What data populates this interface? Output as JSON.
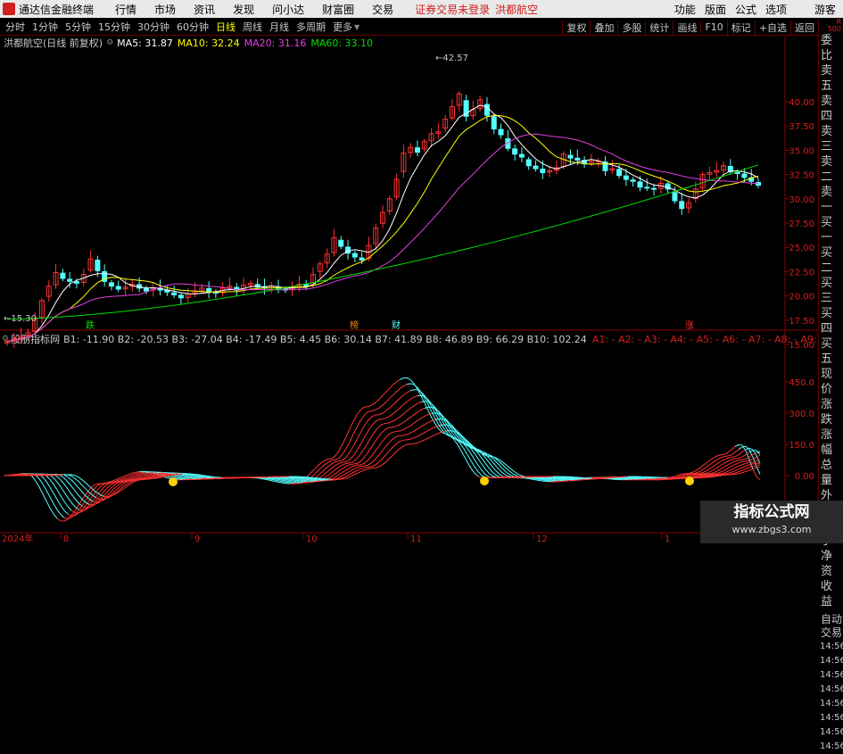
{
  "titlebar": {
    "app": "通达信金融终端",
    "menus": [
      "行情",
      "市场",
      "资讯",
      "发现",
      "问小达",
      "财富圈",
      "交易"
    ],
    "warning": "证券交易未登录",
    "stock": "洪都航空",
    "right": [
      "功能",
      "版面",
      "公式",
      "选项"
    ],
    "guest": "游客"
  },
  "toolbar": {
    "periods": [
      "分时",
      "1分钟",
      "5分钟",
      "15分钟",
      "30分钟",
      "60分钟",
      "日线",
      "周线",
      "月线",
      "多周期",
      "更多"
    ],
    "active": "日线",
    "right": [
      "复权",
      "叠加",
      "多股",
      "统计",
      "画线",
      "F10",
      "标记",
      "+自选",
      "返回"
    ]
  },
  "main_header": {
    "title": "洪都航空(日线 前复权)",
    "ma5": "MA5: 31.87",
    "ma10": "MA10: 32.24",
    "ma20": "MA20: 31.16",
    "ma60": "MA60: 33.10"
  },
  "indicator_header": {
    "title": "股朋指标网",
    "b_values": "B1: -11.90  B2: -20.53  B3: -27.04  B4: -17.49  B5: 4.45  B6: 30.14  B7: 41.89  B8: 46.89  B9: 66.29  B10: 102.24",
    "a_values": "A1: -  A2: -  A3: -  A4: -  A5: -  A6: -  A7: -  A8: -  A9: -  A10: -"
  },
  "sidebar": {
    "top": "R",
    "top2": "500",
    "items": [
      "委比",
      "卖五",
      "卖四",
      "卖三",
      "卖二",
      "卖一",
      "买一",
      "买二",
      "买三",
      "买四",
      "买五",
      "现价",
      "涨跌",
      "涨幅",
      "总量",
      "外盘",
      "换手",
      "净资",
      "收益"
    ],
    "bottom": [
      "自动",
      "交易"
    ],
    "times": [
      "14:56",
      "14:56",
      "14:56",
      "14:56",
      "14:56",
      "14:56",
      "14:56",
      "14:56"
    ]
  },
  "price_axis": [
    "40.00",
    "37.50",
    "35.00",
    "32.50",
    "30.00",
    "27.50",
    "25.00",
    "22.50",
    "20.00",
    "17.50",
    "15.00"
  ],
  "indicator_axis": [
    "450.0",
    "300.0",
    "150.0",
    "0.00"
  ],
  "markers": {
    "high": "42.57",
    "low": "15.30",
    "tags": [
      "跌",
      "榜",
      "财",
      "涨"
    ]
  },
  "xaxis": {
    "year": "2024年",
    "months": [
      "8",
      "9",
      "10",
      "11",
      "12",
      "1"
    ]
  },
  "watermark": {
    "line1": "指标公式网",
    "line2": "www.zbgs3.com"
  },
  "colors": {
    "up": "#ff3232",
    "down": "#54ffff",
    "ma5": "#ffffff",
    "ma10": "#ffff00",
    "ma20": "#e040e0",
    "ma60": "#00e000"
  },
  "chart_data": {
    "type": "candlestick",
    "price_range": [
      14.5,
      44
    ],
    "closes": [
      15.3,
      15.6,
      15.8,
      16.2,
      17.6,
      19.5,
      21,
      22.4,
      21.8,
      21.5,
      21.3,
      22.2,
      23.8,
      22.6,
      21.5,
      21.0,
      20.7,
      20.9,
      21.2,
      20.8,
      20.5,
      20.8,
      20.6,
      20.4,
      20.1,
      19.8,
      20.2,
      20.5,
      20.8,
      20.4,
      20.3,
      20.8,
      21.0,
      20.6,
      21.1,
      21.3,
      20.9,
      20.8,
      21.0,
      20.7,
      20.6,
      20.9,
      21.2,
      21.0,
      22.2,
      23.3,
      24.3,
      26.0,
      25.1,
      24.4,
      24.0,
      23.7,
      25.2,
      27.0,
      28.6,
      30.0,
      32.0,
      34.7,
      35.3,
      34.8,
      35.9,
      36.7,
      36.9,
      38.2,
      39.5,
      40.8,
      38.5,
      39.2,
      40.2,
      38.6,
      37.2,
      36.6,
      35.2,
      34.6,
      34.3,
      33.4,
      33.1,
      32.7,
      32.9,
      33.2,
      34.6,
      34.2,
      34.0,
      33.6,
      33.9,
      33.9,
      32.9,
      33.1,
      32.4,
      32.0,
      31.8,
      31.2,
      31.1,
      31.0,
      31.6,
      31.0,
      29.8,
      29.0,
      29.6,
      31.0,
      32.5,
      32.7,
      32.9,
      33.4,
      32.8,
      32.6,
      32.2,
      31.8,
      31.4
    ]
  }
}
